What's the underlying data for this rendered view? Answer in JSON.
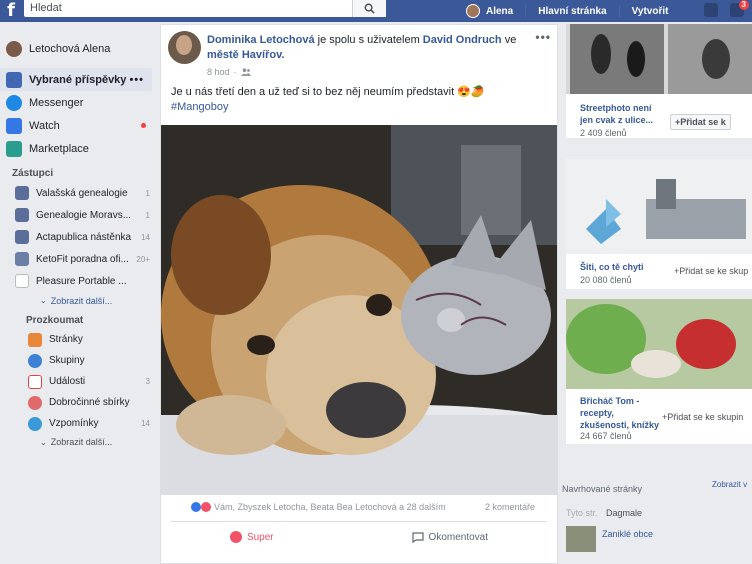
{
  "topbar": {
    "logo": "f",
    "search_placeholder": "Hledat",
    "user_name": "Alena",
    "home": "Hlavní stránka",
    "create": "Vytvořit",
    "notif_count": "3"
  },
  "sidebar": {
    "profile": "Letochová Alena",
    "items": [
      {
        "label": "Vybrané příspěvky",
        "icon": "news-feed-icon"
      },
      {
        "label": "Messenger",
        "icon": "messenger-icon"
      },
      {
        "label": "Watch",
        "icon": "watch-icon"
      },
      {
        "label": "Marketplace",
        "icon": "marketplace-icon"
      }
    ],
    "dots": "•••",
    "shortcuts_title": "Zástupci",
    "shortcuts": [
      {
        "label": "Valašská genealogie",
        "count": "1"
      },
      {
        "label": "Genealogie Moravs...",
        "count": "1"
      },
      {
        "label": "Actapublica nástěnka",
        "count": "14"
      },
      {
        "label": "KetoFit poradna ofi...",
        "count": "20+"
      },
      {
        "label": "Pleasure Portable ...",
        "count": ""
      }
    ],
    "shortcuts_more": "Zobrazit další...",
    "explore_title": "Prozkoumat",
    "explore": [
      {
        "label": "Stránky",
        "count": ""
      },
      {
        "label": "Skupiny",
        "count": ""
      },
      {
        "label": "Události",
        "count": "3"
      },
      {
        "label": "Dobročinné sbírky",
        "count": ""
      },
      {
        "label": "Vzpomínky",
        "count": "14"
      }
    ],
    "explore_more": "Zobrazit další..."
  },
  "post": {
    "author": "Dominika Letochová",
    "with_text": " je spolu s uživatelem ",
    "tagged": "David Ondruch",
    "location_pre": " ve ",
    "location": "městě Havířov.",
    "time": "8 hod",
    "text": "Je u nás třetí den a už teď si to bez něj neumím představit 😍🥭",
    "hashtag": "#Mangoboy",
    "reactions": "Vám, Zbyszek Letocha, Beata Bea Letochová a 28 dalším",
    "comments": "2 komentáře",
    "like": "Super",
    "comment": "Okomentovat",
    "more": "•••"
  },
  "right": {
    "groups": [
      {
        "title": "Streetphoto není jen cvak z ulice...",
        "members": "2 409 členů",
        "join": "Přidat se k"
      },
      {
        "title": "Šiti, co tě chyti",
        "members": "20 080 členů",
        "join": "Přidat se ke skup"
      },
      {
        "title": "Břicháč Tom - recepty, zkušenosti, knížky",
        "members": "24 667 členů",
        "join": "Přidat se ke skupin"
      }
    ],
    "pages_title": "Navrhované stránky",
    "pages_more": "Zobrazit v",
    "page_sub": "Tyto str.",
    "page1": "Dagmale",
    "page2": "Zaniklé obce"
  },
  "colors": {
    "brand": "#3b5998",
    "link": "#365899",
    "bg": "#e9ebee"
  }
}
